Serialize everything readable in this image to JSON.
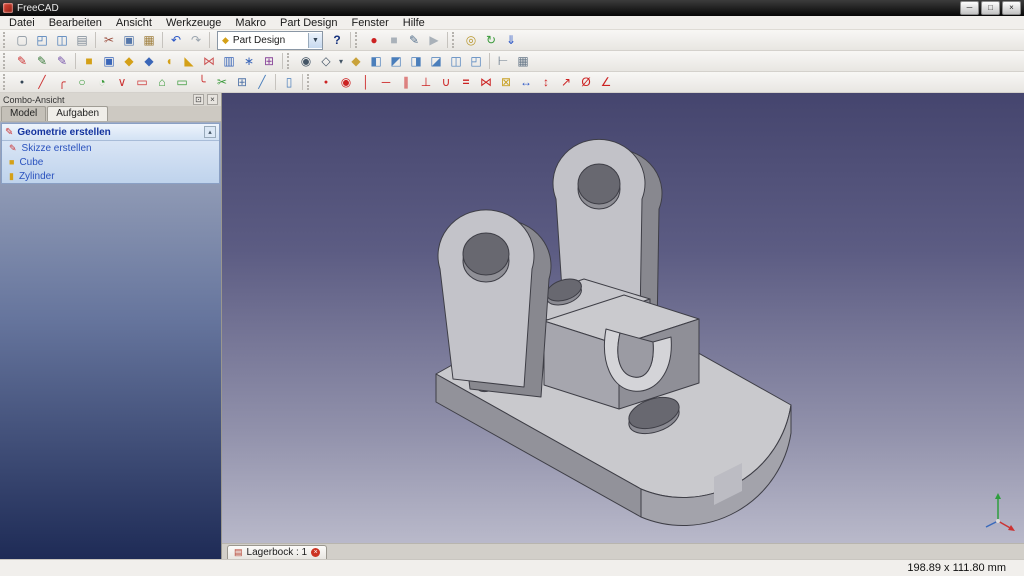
{
  "window": {
    "title": "FreeCAD",
    "controls": [
      {
        "n": "minimize-button",
        "g": "─"
      },
      {
        "n": "maximize-button",
        "g": "□"
      },
      {
        "n": "close-button",
        "g": "×"
      }
    ]
  },
  "menubar": {
    "items": [
      {
        "label": "Datei",
        "nm": "menu-datei"
      },
      {
        "label": "Bearbeiten",
        "nm": "menu-bearbeiten"
      },
      {
        "label": "Ansicht",
        "nm": "menu-ansicht"
      },
      {
        "label": "Werkzeuge",
        "nm": "menu-werkzeuge"
      },
      {
        "label": "Makro",
        "nm": "menu-makro"
      },
      {
        "label": "Part Design",
        "nm": "menu-part-design"
      },
      {
        "label": "Fenster",
        "nm": "menu-fenster"
      },
      {
        "label": "Hilfe",
        "nm": "menu-hilfe"
      }
    ]
  },
  "toolbars": {
    "workbench": {
      "value": "Part Design",
      "icon_glyph": "◆",
      "arrow_glyph": "▼"
    },
    "row1_left": [
      {
        "c": "handle",
        "n": "toolbar-handle",
        "g": "",
        "it": "true"
      },
      {
        "c": "tbi",
        "n": "new-document-icon",
        "g": "▢",
        "s": "color:#7d8a96",
        "it": "true"
      },
      {
        "c": "tbi",
        "n": "open-folder-icon",
        "g": "◰",
        "s": "color:#3f74b5",
        "it": "true"
      },
      {
        "c": "tbi",
        "n": "save-icon",
        "g": "◫",
        "s": "color:#3f74b5",
        "it": "true"
      },
      {
        "c": "tbi",
        "n": "print-icon",
        "g": "▤",
        "s": "color:#7d8a96",
        "it": "true"
      },
      {
        "c": "sep",
        "n": "toolbar-separator",
        "g": "",
        "it": "false"
      },
      {
        "c": "tbi",
        "n": "cut-icon",
        "g": "✂",
        "s": "color:#9a4b3b",
        "it": "true"
      },
      {
        "c": "tbi",
        "n": "copy-icon",
        "g": "▣",
        "s": "color:#5577aa",
        "it": "true"
      },
      {
        "c": "tbi",
        "n": "paste-icon",
        "g": "▦",
        "s": "color:#a08040",
        "it": "true"
      },
      {
        "c": "sep",
        "n": "toolbar-separator",
        "g": "",
        "it": "false"
      },
      {
        "c": "tbi",
        "n": "undo-icon",
        "g": "↶",
        "s": "color:#2a56c6",
        "it": "true"
      },
      {
        "c": "tbi",
        "n": "redo-icon",
        "g": "↷",
        "s": "color:#9aa4ae",
        "it": "true"
      },
      {
        "c": "sep",
        "n": "toolbar-separator",
        "g": "",
        "it": "false"
      }
    ],
    "row1_right": [
      {
        "c": "tbi",
        "n": "whats-this-icon",
        "g": "?",
        "s": "color:#14317c;font-weight:bold",
        "it": "true"
      },
      {
        "c": "sep",
        "n": "toolbar-separator",
        "g": "",
        "it": "false"
      },
      {
        "c": "handle",
        "n": "toolbar-handle",
        "g": "",
        "it": "true"
      },
      {
        "c": "tbi",
        "n": "macro-record-icon",
        "g": "●",
        "s": "color:#cc2222",
        "it": "true"
      },
      {
        "c": "tbi",
        "n": "macro-stop-icon",
        "g": "■",
        "s": "color:#a9b1b9",
        "it": "true"
      },
      {
        "c": "tbi",
        "n": "macro-edit-icon",
        "g": "✎",
        "s": "color:#55708c",
        "it": "true"
      },
      {
        "c": "tbi",
        "n": "macro-play-icon",
        "g": "▶",
        "s": "color:#a9b1b9",
        "it": "true"
      },
      {
        "c": "sep",
        "n": "toolbar-separator",
        "g": "",
        "it": "false"
      },
      {
        "c": "handle",
        "n": "toolbar-handle",
        "g": "",
        "it": "true"
      },
      {
        "c": "tbi",
        "n": "web-browser-icon",
        "g": "◎",
        "s": "color:#b8972e",
        "it": "true"
      },
      {
        "c": "tbi",
        "n": "refresh-icon",
        "g": "↻",
        "s": "color:#3a9a3a",
        "it": "true"
      },
      {
        "c": "tbi",
        "n": "download-icon",
        "g": "⇓",
        "s": "color:#2a56c6",
        "it": "true"
      }
    ],
    "row2": [
      {
        "c": "handle",
        "n": "toolbar-handle",
        "g": "",
        "it": "true"
      },
      {
        "c": "tbi",
        "n": "create-sketch-icon",
        "g": "✎",
        "s": "color:#cc3333",
        "it": "true"
      },
      {
        "c": "tbi",
        "n": "edit-sketch-icon",
        "g": "✎",
        "s": "color:#3a7a3a",
        "it": "true"
      },
      {
        "c": "tbi",
        "n": "map-sketch-icon",
        "g": "✎",
        "s": "color:#7755aa",
        "it": "true"
      },
      {
        "c": "sep",
        "n": "toolbar-separator",
        "g": "",
        "it": "false"
      },
      {
        "c": "tbi",
        "n": "pad-icon",
        "g": "■",
        "s": "color:#d4a017",
        "it": "true"
      },
      {
        "c": "tbi",
        "n": "pocket-icon",
        "g": "▣",
        "s": "color:#3a66b8",
        "it": "true"
      },
      {
        "c": "tbi",
        "n": "revolution-icon",
        "g": "◆",
        "s": "color:#d4a017",
        "it": "true"
      },
      {
        "c": "tbi",
        "n": "groove-icon",
        "g": "◆",
        "s": "color:#3a66b8",
        "it": "true"
      },
      {
        "c": "tbi",
        "n": "fillet-icon",
        "g": "◖",
        "s": "color:#d4a017",
        "it": "true"
      },
      {
        "c": "tbi",
        "n": "chamfer-icon",
        "g": "◣",
        "s": "color:#d4a017",
        "it": "true"
      },
      {
        "c": "tbi",
        "n": "mirrored-icon",
        "g": "⋈",
        "s": "color:#cc5555",
        "it": "true"
      },
      {
        "c": "tbi",
        "n": "linear-pattern-icon",
        "g": "▥",
        "s": "color:#3a66b8",
        "it": "true"
      },
      {
        "c": "tbi",
        "n": "polar-pattern-icon",
        "g": "∗",
        "s": "color:#3a66b8",
        "it": "true"
      },
      {
        "c": "tbi",
        "n": "multitransform-icon",
        "g": "⊞",
        "s": "color:#884499",
        "it": "true"
      },
      {
        "c": "sep",
        "n": "toolbar-separator",
        "g": "",
        "it": "false"
      },
      {
        "c": "handle",
        "n": "toolbar-handle",
        "g": "",
        "it": "true"
      },
      {
        "c": "tbi",
        "n": "fit-all-icon",
        "g": "◉",
        "s": "color:#445566",
        "it": "true"
      },
      {
        "c": "tbi",
        "n": "draw-style-icon",
        "g": "◇",
        "s": "color:#445566",
        "it": "true"
      },
      {
        "c": "tbi dd",
        "n": "draw-style-arrow-icon",
        "g": "▾",
        "s": "color:#445566",
        "it": "true"
      },
      {
        "c": "tbi",
        "n": "view-isometric-icon",
        "g": "◆",
        "s": "color:#c9a23a",
        "it": "true"
      },
      {
        "c": "tbi",
        "n": "view-front-icon",
        "g": "◧",
        "s": "color:#4a7ebb",
        "it": "true"
      },
      {
        "c": "tbi",
        "n": "view-top-icon",
        "g": "◩",
        "s": "color:#4a7ebb",
        "it": "true"
      },
      {
        "c": "tbi",
        "n": "view-right-icon",
        "g": "◨",
        "s": "color:#4a7ebb",
        "it": "true"
      },
      {
        "c": "tbi",
        "n": "view-rear-icon",
        "g": "◪",
        "s": "color:#4a7ebb",
        "it": "true"
      },
      {
        "c": "tbi",
        "n": "view-bottom-icon",
        "g": "◫",
        "s": "color:#4a7ebb",
        "it": "true"
      },
      {
        "c": "tbi",
        "n": "view-left-icon",
        "g": "◰",
        "s": "color:#4a7ebb",
        "it": "true"
      },
      {
        "c": "sep",
        "n": "toolbar-separator",
        "g": "",
        "it": "false"
      },
      {
        "c": "tbi",
        "n": "measure-distance-icon",
        "g": "⊢",
        "s": "color:#667788",
        "it": "true"
      },
      {
        "c": "tbi",
        "n": "scene-inspector-icon",
        "g": "▦",
        "s": "color:#667788",
        "it": "true"
      }
    ],
    "row3": [
      {
        "c": "handle",
        "n": "toolbar-handle",
        "g": "",
        "it": "true"
      },
      {
        "c": "tbi",
        "n": "point-icon",
        "g": "●",
        "s": "color:#334455;font-size:7px",
        "it": "true"
      },
      {
        "c": "tbi",
        "n": "line-icon",
        "g": "╱",
        "s": "color:#cc3333",
        "it": "true"
      },
      {
        "c": "tbi",
        "n": "arc-icon",
        "g": "╭",
        "s": "color:#cc3333",
        "it": "true"
      },
      {
        "c": "tbi",
        "n": "circle-icon",
        "g": "○",
        "s": "color:#3a9a3a",
        "it": "true"
      },
      {
        "c": "tbi",
        "n": "conic-icon",
        "g": "◔",
        "s": "color:#3a9a3a",
        "it": "true"
      },
      {
        "c": "tbi",
        "n": "polyline-icon",
        "g": "∨",
        "s": "color:#cc3333",
        "it": "true"
      },
      {
        "c": "tbi",
        "n": "rectangle-icon",
        "g": "▭",
        "s": "color:#cc3333",
        "it": "true"
      },
      {
        "c": "tbi",
        "n": "polygon-icon",
        "g": "⌂",
        "s": "color:#3a9a3a",
        "it": "true"
      },
      {
        "c": "tbi",
        "n": "slot-icon",
        "g": "▭",
        "s": "color:#3a9a3a",
        "it": "true"
      },
      {
        "c": "tbi",
        "n": "fillet-sketch-icon",
        "g": "╰",
        "s": "color:#cc3333",
        "it": "true"
      },
      {
        "c": "tbi",
        "n": "trim-icon",
        "g": "✂",
        "s": "color:#3a9a3a",
        "it": "true"
      },
      {
        "c": "tbi",
        "n": "external-geometry-icon",
        "g": "⊞",
        "s": "color:#5577aa",
        "it": "true"
      },
      {
        "c": "tbi",
        "n": "construction-mode-icon",
        "g": "╱",
        "s": "color:#4a7ebb",
        "it": "true"
      },
      {
        "c": "sep",
        "n": "toolbar-separator",
        "g": "",
        "it": "false"
      },
      {
        "c": "tbi",
        "n": "sketch-view-icon",
        "g": "▯",
        "s": "color:#4a7ebb",
        "it": "true"
      },
      {
        "c": "sep",
        "n": "toolbar-separator",
        "g": "",
        "it": "false"
      },
      {
        "c": "handle",
        "n": "toolbar-handle",
        "g": "",
        "it": "true"
      },
      {
        "c": "tbi",
        "n": "constraint-coincident-icon",
        "g": "●",
        "s": "color:#cc2222;font-size:7px",
        "it": "true"
      },
      {
        "c": "tbi",
        "n": "constraint-point-on-object-icon",
        "g": "◉",
        "s": "color:#cc2222",
        "it": "true"
      },
      {
        "c": "tbi",
        "n": "constraint-vertical-icon",
        "g": "│",
        "s": "color:#cc2222",
        "it": "true"
      },
      {
        "c": "tbi",
        "n": "constraint-horizontal-icon",
        "g": "─",
        "s": "color:#cc2222",
        "it": "true"
      },
      {
        "c": "tbi",
        "n": "constraint-parallel-icon",
        "g": "∥",
        "s": "color:#cc2222",
        "it": "true"
      },
      {
        "c": "tbi",
        "n": "constraint-perpendicular-icon",
        "g": "⊥",
        "s": "color:#cc2222",
        "it": "true"
      },
      {
        "c": "tbi",
        "n": "constraint-tangent-icon",
        "g": "∪",
        "s": "color:#cc2222",
        "it": "true"
      },
      {
        "c": "tbi",
        "n": "constraint-equal-icon",
        "g": "=",
        "s": "color:#cc2222;font-weight:bold",
        "it": "true"
      },
      {
        "c": "tbi",
        "n": "constraint-symmetric-icon",
        "g": "⋈",
        "s": "color:#cc2222",
        "it": "true"
      },
      {
        "c": "tbi",
        "n": "constraint-lock-icon",
        "g": "⊠",
        "s": "color:#c9a227",
        "it": "true"
      },
      {
        "c": "tbi",
        "n": "constraint-horizontal-distance-icon",
        "g": "↔",
        "s": "color:#2a56c6",
        "it": "true"
      },
      {
        "c": "tbi",
        "n": "constraint-vertical-distance-icon",
        "g": "↕",
        "s": "color:#cc2222",
        "it": "true"
      },
      {
        "c": "tbi",
        "n": "constraint-distance-icon",
        "g": "↗",
        "s": "color:#cc2222",
        "it": "true"
      },
      {
        "c": "tbi",
        "n": "constraint-radius-icon",
        "g": "Ø",
        "s": "color:#cc2222",
        "it": "true"
      },
      {
        "c": "tbi",
        "n": "constraint-angle-icon",
        "g": "∠",
        "s": "color:#cc2222",
        "it": "true"
      }
    ]
  },
  "combo_view": {
    "title": "Combo-Ansicht",
    "dock_glyph": "⊡",
    "close_glyph": "×",
    "tabs": [
      {
        "label": "Model",
        "c": "tab",
        "nm": "tab-model",
        "it": "true"
      },
      {
        "label": "Aufgaben",
        "c": "tab active",
        "nm": "tab-aufgaben",
        "it": "true"
      }
    ],
    "task_header": {
      "icon_glyph": "✎",
      "label": "Geometrie erstellen",
      "collapse_glyph": "▴"
    },
    "task_items": [
      {
        "nm": "task-item-skizze-erstellen",
        "g": "✎",
        "gs": "color:#cc3333",
        "label": "Skizze erstellen",
        "ls": "color:#2a52be"
      },
      {
        "nm": "task-item-cube",
        "g": "■",
        "gs": "color:#d4a017",
        "label": "Cube",
        "ls": "color:#2a52be"
      },
      {
        "nm": "task-item-zylinder",
        "g": "▮",
        "gs": "color:#d4a017",
        "label": "Zylinder",
        "ls": "color:#2a52be"
      }
    ]
  },
  "document_tabs": [
    {
      "nm": "document-tab-lagerbock",
      "icon_glyph": "▤",
      "label": "Lagerbock : 1",
      "close_glyph": "×"
    }
  ],
  "statusbar": {
    "dimensions": "198.89 x 111.80 mm"
  },
  "colors": {
    "viewport_gradient_top": "#45456e",
    "viewport_gradient_bottom": "#b9b9ca",
    "model_gray": "#c6c6cb",
    "task_link_blue": "#2a52be",
    "close_red": "#cc3322"
  }
}
